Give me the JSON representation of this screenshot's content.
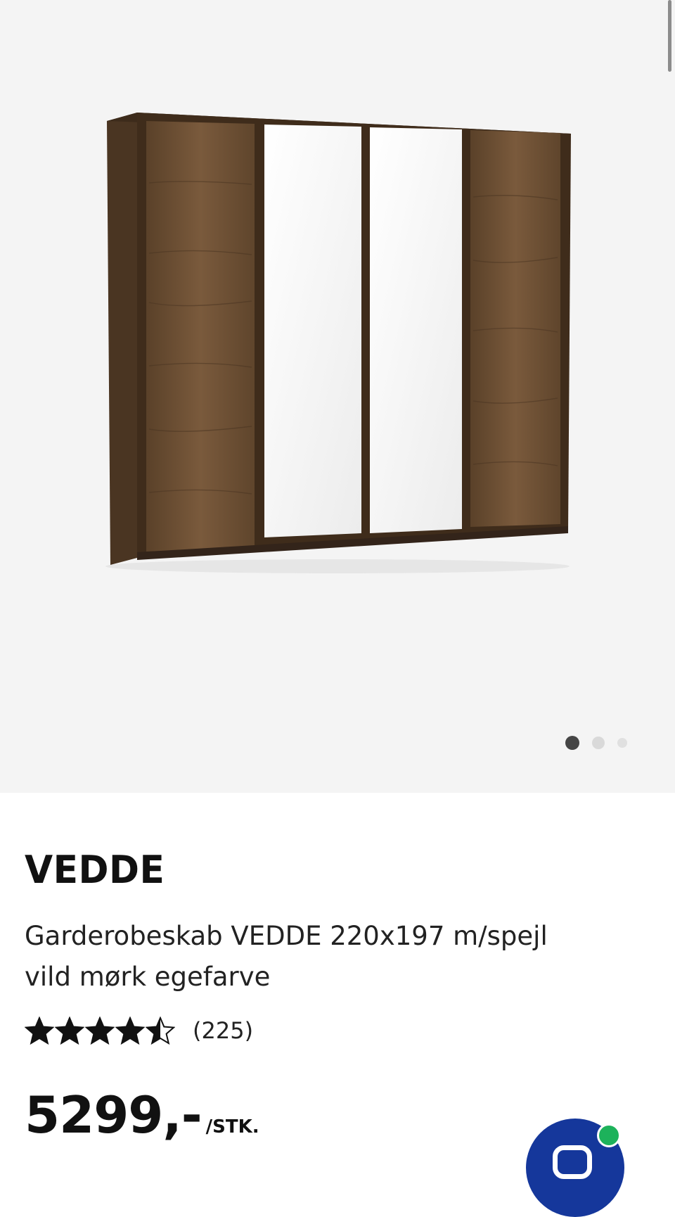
{
  "gallery": {
    "image_alt": "Garderobeskab VEDDE",
    "dots_total": 3,
    "active_dot": 1
  },
  "product": {
    "brand": "VEDDE",
    "description": "Garderobeskab VEDDE 220x197 m/spejl vild mørk egefarve",
    "rating": {
      "value": 4.5,
      "max": 5,
      "count": "(225)"
    },
    "price": "5299,-",
    "unit": "/STK."
  },
  "chat": {
    "icon": "chat-bubble-icon",
    "status_icon": "online-status-icon"
  },
  "colors": {
    "gallery_bg": "#f4f4f4",
    "wood": "#6b4e33",
    "chat_button": "#15379b",
    "online": "#1db25b"
  }
}
